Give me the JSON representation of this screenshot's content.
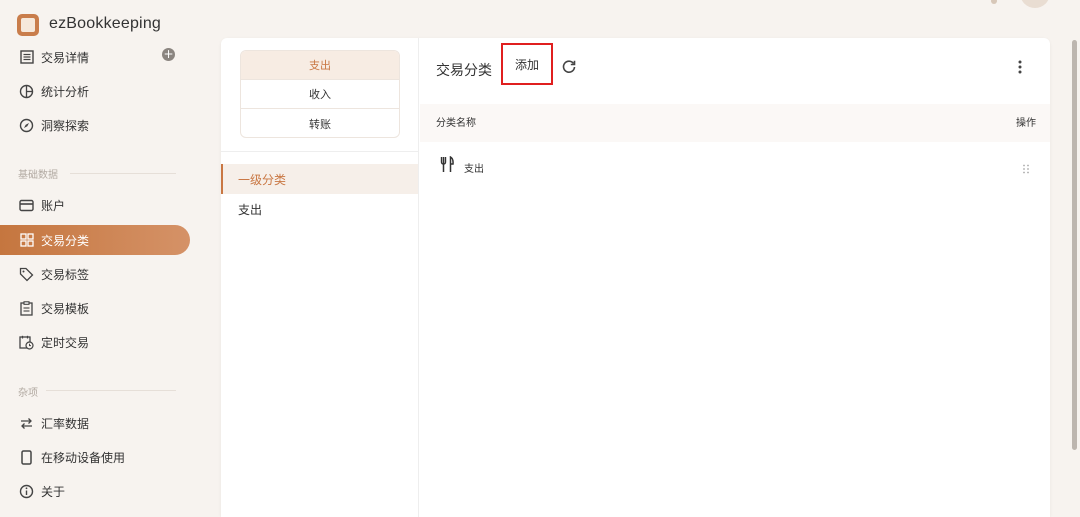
{
  "app": {
    "title": "ezBookkeeping"
  },
  "sidebar": {
    "items": [
      {
        "label": "交易详情",
        "icon": "list-icon"
      },
      {
        "label": "统计分析",
        "icon": "pie-chart-icon"
      },
      {
        "label": "洞察探索",
        "icon": "compass-icon"
      }
    ],
    "section_basic": "基础数据",
    "basic_items": [
      {
        "label": "账户",
        "icon": "card-icon"
      },
      {
        "label": "交易分类",
        "icon": "grid-icon",
        "active": true
      },
      {
        "label": "交易标签",
        "icon": "tag-icon"
      },
      {
        "label": "交易模板",
        "icon": "clipboard-icon"
      },
      {
        "label": "定时交易",
        "icon": "calendar-clock-icon"
      }
    ],
    "section_misc": "杂项",
    "misc_items": [
      {
        "label": "汇率数据",
        "icon": "exchange-icon"
      },
      {
        "label": "在移动设备使用",
        "icon": "phone-icon"
      },
      {
        "label": "关于",
        "icon": "info-icon"
      }
    ]
  },
  "types": [
    "支出",
    "收入",
    "转账"
  ],
  "selected_type": "支出",
  "levels": {
    "primary": "一级分类",
    "current": "支出"
  },
  "panel": {
    "title": "交易分类",
    "add_label": "添加",
    "col_name": "分类名称",
    "col_op": "操作"
  },
  "categories": [
    {
      "name": "支出",
      "icon": "utensils-icon"
    }
  ],
  "colors": {
    "accent": "#c97743",
    "highlight_border": "#e01f1f"
  }
}
